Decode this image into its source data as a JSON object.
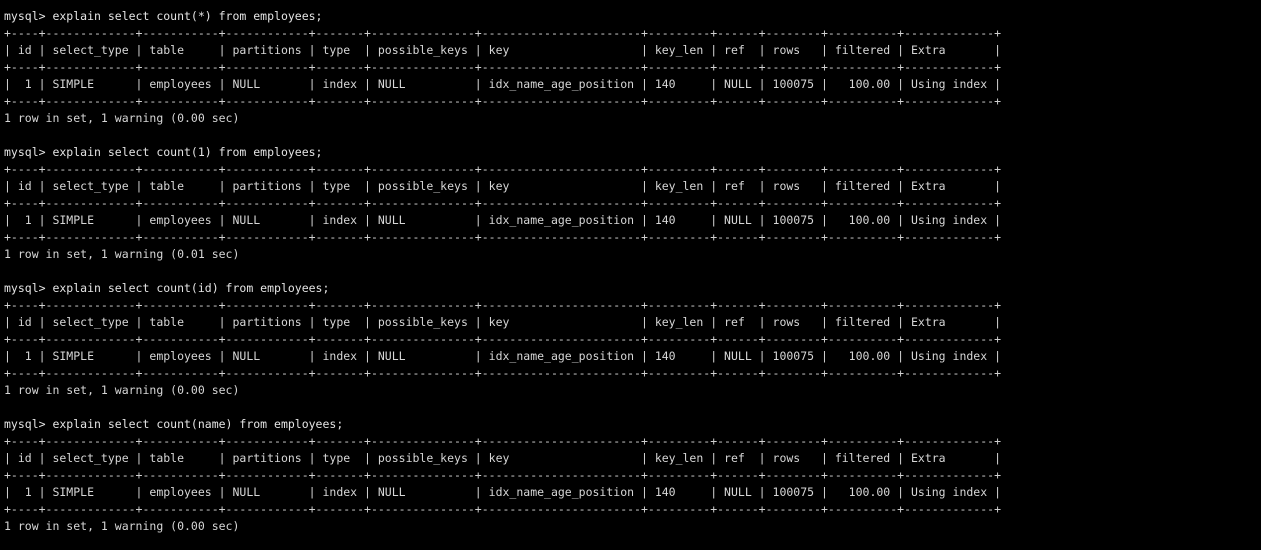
{
  "terminal": {
    "title": "mysql",
    "prompt": "mysql> ",
    "background_color": "#000000",
    "foreground_color": "#d6d6d6",
    "columns": [
      {
        "name": "id",
        "width": 4,
        "align": "right"
      },
      {
        "name": "select_type",
        "width": 13,
        "align": "left"
      },
      {
        "name": "table",
        "width": 11,
        "align": "left"
      },
      {
        "name": "partitions",
        "width": 12,
        "align": "left"
      },
      {
        "name": "type",
        "width": 7,
        "align": "left"
      },
      {
        "name": "possible_keys",
        "width": 15,
        "align": "left"
      },
      {
        "name": "key",
        "width": 23,
        "align": "left"
      },
      {
        "name": "key_len",
        "width": 9,
        "align": "left"
      },
      {
        "name": "ref",
        "width": 6,
        "align": "left"
      },
      {
        "name": "rows",
        "width": 8,
        "align": "right"
      },
      {
        "name": "filtered",
        "width": 10,
        "align": "right"
      },
      {
        "name": "Extra",
        "width": 13,
        "align": "left"
      }
    ],
    "blocks": [
      {
        "command": "explain select count(*) from employees;",
        "rows": [
          {
            "id": "1",
            "select_type": "SIMPLE",
            "table": "employees",
            "partitions": "NULL",
            "type": "index",
            "possible_keys": "NULL",
            "key": "idx_name_age_position",
            "key_len": "140",
            "ref": "NULL",
            "rows": "100075",
            "filtered": "100.00",
            "Extra": "Using index"
          }
        ],
        "status": "1 row in set, 1 warning (0.00 sec)"
      },
      {
        "command": "explain select count(1) from employees;",
        "rows": [
          {
            "id": "1",
            "select_type": "SIMPLE",
            "table": "employees",
            "partitions": "NULL",
            "type": "index",
            "possible_keys": "NULL",
            "key": "idx_name_age_position",
            "key_len": "140",
            "ref": "NULL",
            "rows": "100075",
            "filtered": "100.00",
            "Extra": "Using index"
          }
        ],
        "status": "1 row in set, 1 warning (0.01 sec)"
      },
      {
        "command": "explain select count(id) from employees;",
        "rows": [
          {
            "id": "1",
            "select_type": "SIMPLE",
            "table": "employees",
            "partitions": "NULL",
            "type": "index",
            "possible_keys": "NULL",
            "key": "idx_name_age_position",
            "key_len": "140",
            "ref": "NULL",
            "rows": "100075",
            "filtered": "100.00",
            "Extra": "Using index"
          }
        ],
        "status": "1 row in set, 1 warning (0.00 sec)"
      },
      {
        "command": "explain select count(name) from employees;",
        "rows": [
          {
            "id": "1",
            "select_type": "SIMPLE",
            "table": "employees",
            "partitions": "NULL",
            "type": "index",
            "possible_keys": "NULL",
            "key": "idx_name_age_position",
            "key_len": "140",
            "ref": "NULL",
            "rows": "100075",
            "filtered": "100.00",
            "Extra": "Using index"
          }
        ],
        "status": "1 row in set, 1 warning (0.00 sec)"
      }
    ]
  }
}
